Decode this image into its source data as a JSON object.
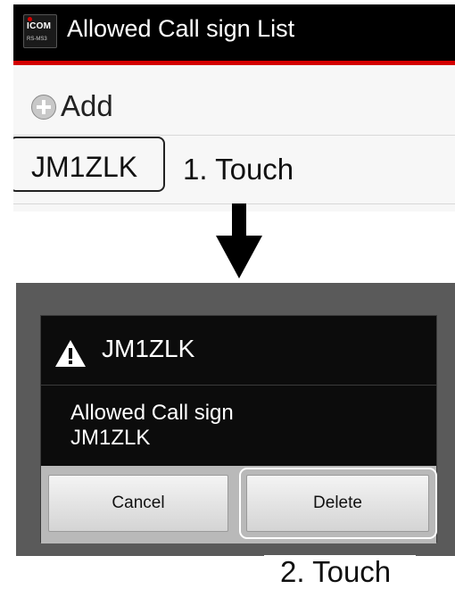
{
  "step1": {
    "app_icon": {
      "brand": "ICOM",
      "sub": "RS-MS3"
    },
    "title": "Allowed Call sign List",
    "add_label": "Add",
    "callsign": "JM1ZLK",
    "instruction": "1. Touch"
  },
  "step2": {
    "dialog_title": "JM1ZLK",
    "message_line1": "Allowed Call sign",
    "message_line2": "JM1ZLK",
    "cancel_label": "Cancel",
    "delete_label": "Delete",
    "instruction": "2. Touch"
  },
  "icons": {
    "add": "plus-circle-icon",
    "warning": "warning-triangle-icon",
    "arrow": "down-arrow-icon"
  },
  "colors": {
    "titlebar": "#000000",
    "accent_red": "#d40000",
    "dialog_bg": "#0c0c0c",
    "button_bar": "#b9b9b9",
    "dim_background": "#5a5a5a"
  }
}
